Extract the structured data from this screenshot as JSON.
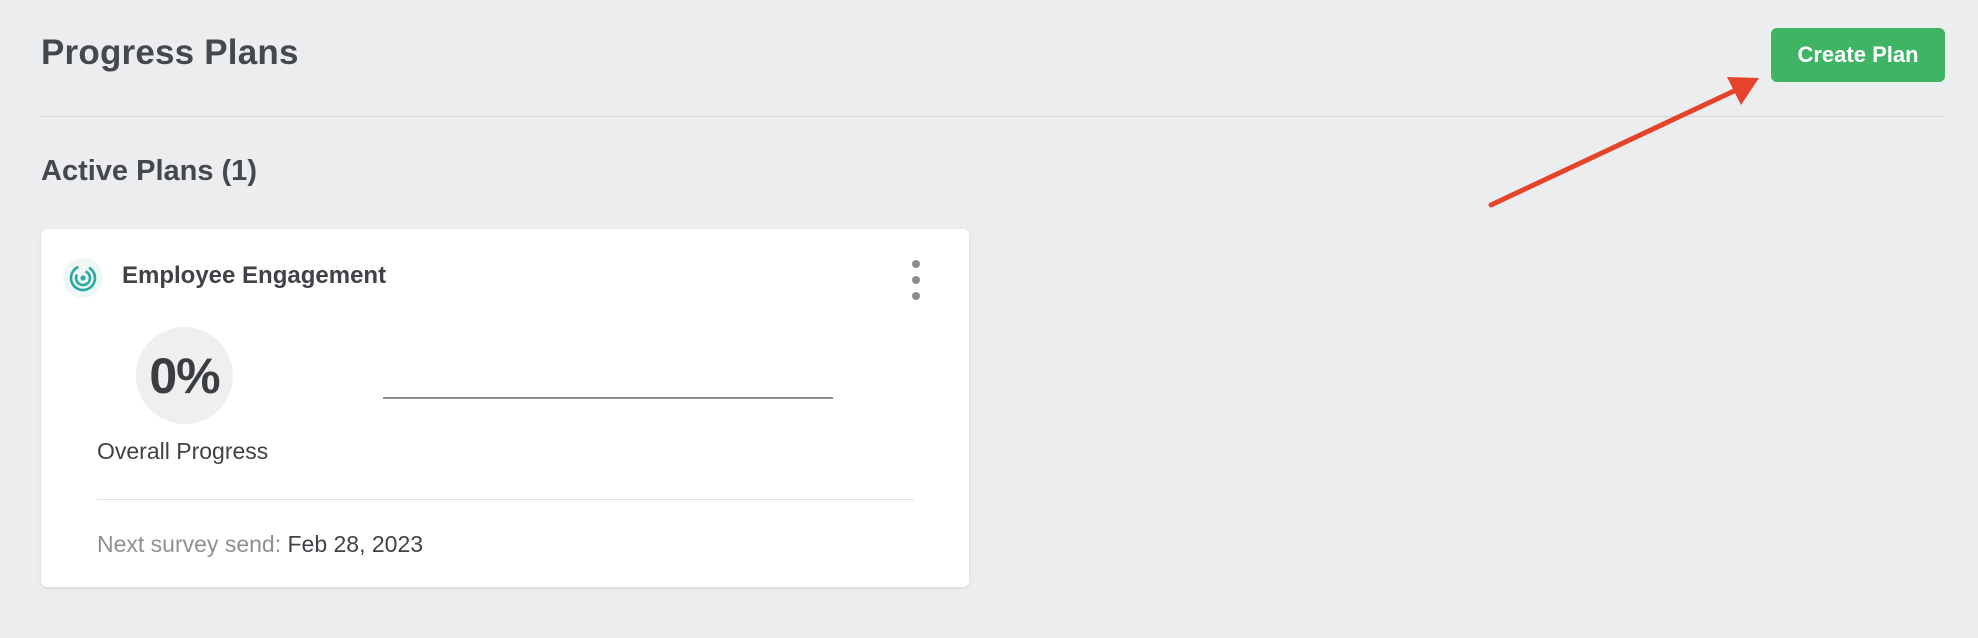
{
  "header": {
    "title": "Progress Plans",
    "create_button_label": "Create Plan"
  },
  "active_plans": {
    "heading": "Active Plans (1)",
    "plans": [
      {
        "name": "Employee Engagement",
        "icon": "target-ring-icon",
        "progress_value": "0%",
        "progress_label": "Overall Progress",
        "next_survey_label": "Next survey send:",
        "next_survey_date": "Feb 28, 2023"
      }
    ]
  },
  "colors": {
    "background": "#ecedef",
    "primary_button": "#3fb464",
    "plan_icon": "#2aa9a0",
    "annotation_arrow": "#e5432a"
  },
  "annotation": {
    "arrow_icon": "annotation-arrow",
    "points_to": "create-plan-button"
  }
}
